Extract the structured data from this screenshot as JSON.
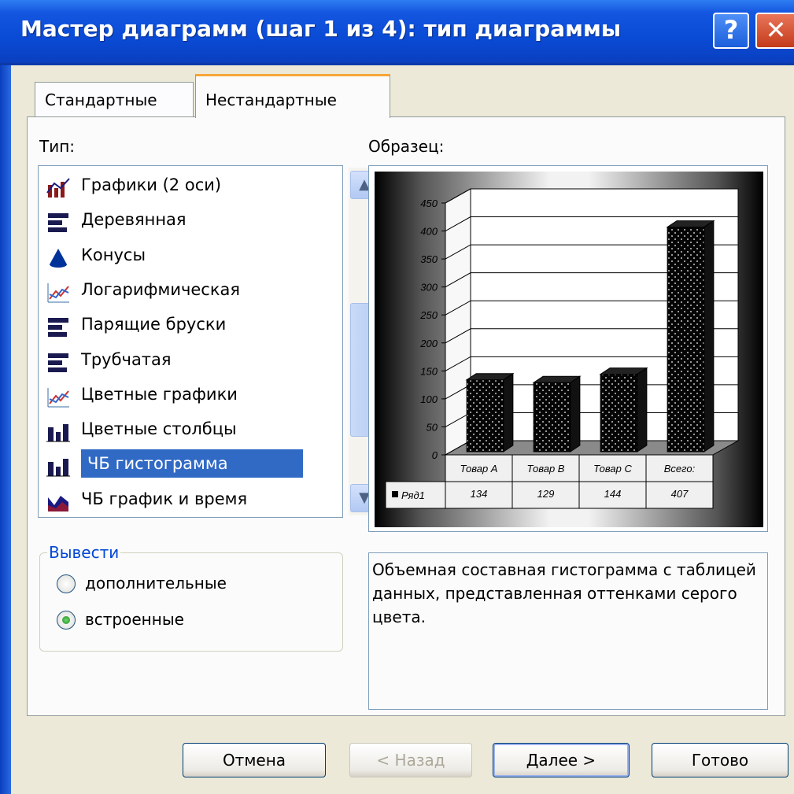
{
  "window": {
    "title": "Мастер диаграмм (шаг 1 из 4): тип диаграммы",
    "help": "?",
    "close": "✕"
  },
  "tabs": [
    {
      "label": "Стандартные"
    },
    {
      "label": "Нестандартные",
      "active": true
    }
  ],
  "type_label": "Тип:",
  "type_list": [
    {
      "label": "Графики (2 оси)",
      "icon": "chart-line-2axes-icon"
    },
    {
      "label": "Деревянная",
      "icon": "bar-icon"
    },
    {
      "label": "Конусы",
      "icon": "cone-icon"
    },
    {
      "label": "Логарифмическая",
      "icon": "line-chart-icon"
    },
    {
      "label": "Парящие бруски",
      "icon": "bar-icon"
    },
    {
      "label": "Трубчатая",
      "icon": "bar-icon"
    },
    {
      "label": "Цветные графики",
      "icon": "line-chart-icon"
    },
    {
      "label": "Цветные столбцы",
      "icon": "column-icon"
    },
    {
      "label": "ЧБ гистограмма",
      "icon": "column-icon",
      "selected": true
    },
    {
      "label": "ЧБ график и время",
      "icon": "area-icon"
    }
  ],
  "output_group": {
    "legend": "Вывести",
    "options": [
      {
        "label": "дополнительные",
        "checked": false
      },
      {
        "label": "встроенные",
        "checked": true
      }
    ]
  },
  "sample_label": "Образец:",
  "description": "Объемная составная гистограмма с таблицей данных, представленная оттенками серого цвета.",
  "buttons": {
    "cancel": "Отмена",
    "back": "< Назад",
    "next": "Далее >",
    "finish": "Готово"
  },
  "colors": {
    "selection": "#316ac5",
    "titlebar": "#0a4bd6",
    "tab_accent": "#f5a636"
  },
  "chart_data": {
    "type": "bar",
    "categories": [
      "Товар A",
      "Товар B",
      "Товар C",
      "Всего:"
    ],
    "series": [
      {
        "name": "Ряд1",
        "values": [
          134,
          129,
          144,
          407
        ]
      }
    ],
    "y_ticks": [
      "0",
      "50",
      "100",
      "150",
      "200",
      "250",
      "300",
      "350",
      "400",
      "450"
    ],
    "ylim": [
      0,
      450
    ],
    "data_table": true
  }
}
